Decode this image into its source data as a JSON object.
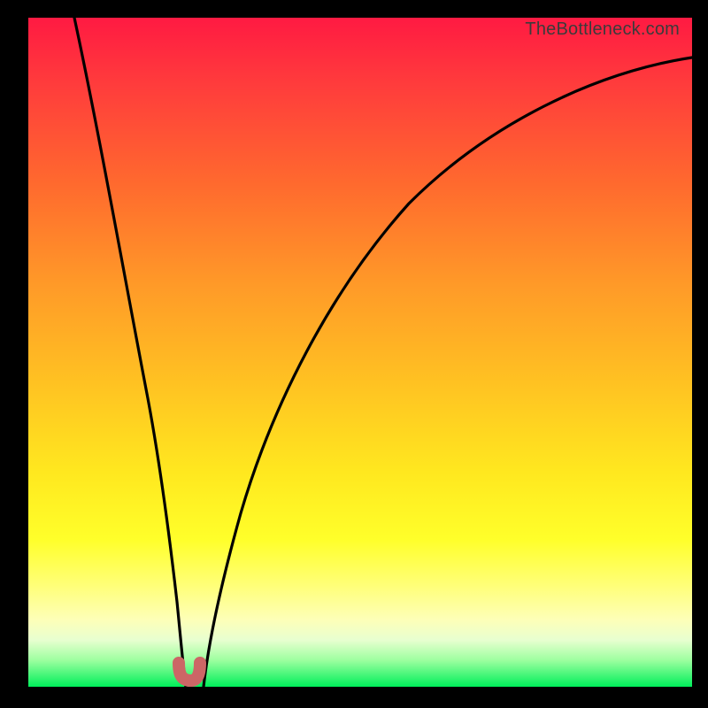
{
  "watermark": "TheBottleneck.com",
  "chart_data": {
    "type": "line",
    "title": "",
    "xlabel": "",
    "ylabel": "",
    "xlim": [
      0,
      100
    ],
    "ylim": [
      0,
      100
    ],
    "grid": false,
    "legend": false,
    "series": [
      {
        "name": "curve-left",
        "x": [
          7,
          10,
          13,
          16,
          18,
          20,
          21.5,
          22.5,
          23
        ],
        "y": [
          100,
          81,
          62,
          43,
          30,
          17,
          7,
          2,
          0
        ]
      },
      {
        "name": "curve-right",
        "x": [
          26,
          27,
          29,
          32,
          37,
          45,
          55,
          65,
          75,
          85,
          95,
          100
        ],
        "y": [
          0,
          4,
          13,
          27,
          43,
          61,
          74,
          82,
          88,
          91.5,
          93.5,
          94
        ]
      },
      {
        "name": "bottom-marker",
        "x": [
          22.5,
          22.8,
          23.3,
          24.2,
          25.1,
          25.6,
          25.9
        ],
        "y": [
          3.3,
          1.8,
          0.9,
          0.8,
          0.9,
          1.8,
          3.3
        ]
      }
    ],
    "marker_color": "#cc6666"
  }
}
